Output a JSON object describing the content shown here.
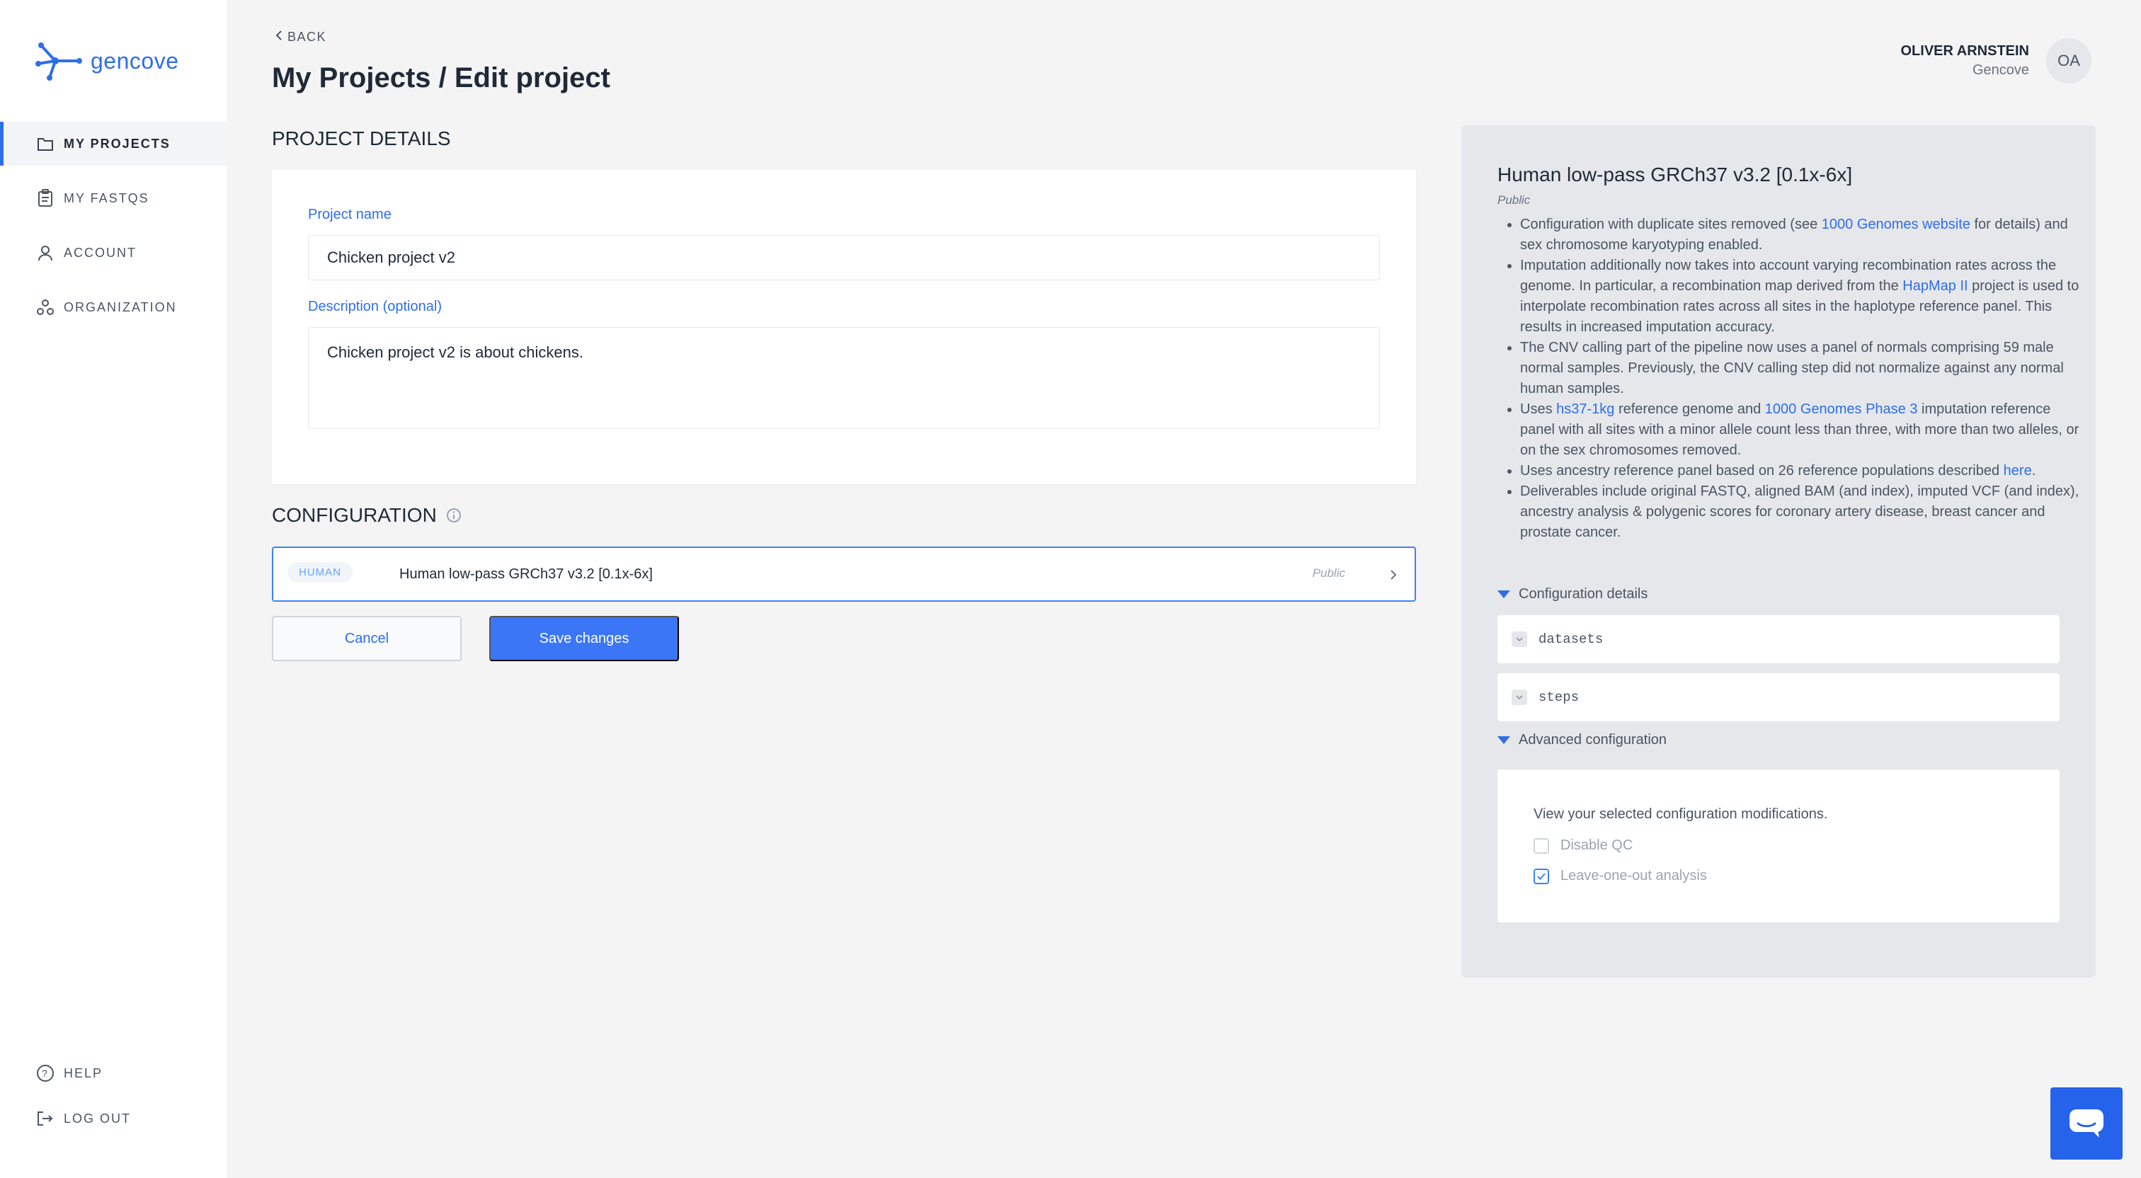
{
  "brand": {
    "name": "gencove",
    "accent": "#2f6ee6"
  },
  "nav": {
    "items": [
      {
        "label": "MY PROJECTS",
        "icon": "folder-icon",
        "active": true
      },
      {
        "label": "MY FASTQS",
        "icon": "clipboard-icon"
      },
      {
        "label": "ACCOUNT",
        "icon": "user-icon"
      },
      {
        "label": "ORGANIZATION",
        "icon": "organization-icon"
      }
    ],
    "bottom": [
      {
        "label": "HELP",
        "icon": "help-icon"
      },
      {
        "label": "LOG OUT",
        "icon": "logout-icon"
      }
    ]
  },
  "header": {
    "back_label": "BACK",
    "title": "My Projects / Edit project",
    "user_name": "OLIVER ARNSTEIN",
    "user_org": "Gencove",
    "avatar_initials": "OA"
  },
  "project_details": {
    "section_title": "PROJECT DETAILS",
    "name_label": "Project name",
    "name_value": "Chicken project v2",
    "description_label": "Description (optional)",
    "description_value": "Chicken project v2 is about chickens."
  },
  "configuration": {
    "section_title": "CONFIGURATION",
    "tag": "HUMAN",
    "name": "Human low-pass GRCh37 v3.2 [0.1x-6x]",
    "visibility": "Public"
  },
  "actions": {
    "cancel_label": "Cancel",
    "save_label": "Save changes"
  },
  "panel": {
    "title": "Human low-pass GRCh37 v3.2 [0.1x-6x]",
    "subtitle": "Public",
    "bullets": {
      "b1_pre": "Configuration with duplicate sites removed (see ",
      "b1_link": "1000 Genomes website",
      "b1_post": " for details) and sex chromosome karyotyping enabled.",
      "b2_pre": "Imputation additionally now takes into account varying recombination rates across the genome. In particular, a recombination map derived from the ",
      "b2_link": "HapMap II",
      "b2_post": " project is used to interpolate recombination rates across all sites in the haplotype reference panel. This results in increased imputation accuracy.",
      "b3": "The CNV calling part of the pipeline now uses a panel of normals comprising 59 male normal samples. Previously, the CNV calling step did not normalize against any normal human samples.",
      "b4_pre": "Uses ",
      "b4_link1": "hs37-1kg",
      "b4_mid": " reference genome and ",
      "b4_link2": "1000 Genomes Phase 3",
      "b4_post": " imputation reference panel with all sites with a minor allele count less than three, with more than two alleles, or on the sex chromosomes removed.",
      "b5_pre": "Uses ancestry reference panel based on 26 reference populations described ",
      "b5_link": "here",
      "b5_post": ".",
      "b6": "Deliverables include original FASTQ, aligned BAM (and index), imputed VCF (and index), ancestry analysis & polygenic scores for coronary artery disease, breast cancer and prostate cancer."
    },
    "config_details_label": "Configuration details",
    "datasets_label": "datasets",
    "steps_label": "steps",
    "advanced_label": "Advanced configuration",
    "advanced_text": "View your selected configuration modifications.",
    "disable_qc_label": "Disable QC",
    "disable_qc_checked": false,
    "leave_one_out_label": "Leave-one-out analysis",
    "leave_one_out_checked": true
  },
  "chat": {
    "icon": "chat-icon"
  }
}
